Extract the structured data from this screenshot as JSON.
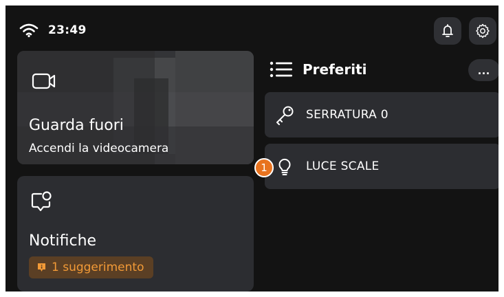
{
  "status_bar": {
    "time": "23:49",
    "wifi_icon": "wifi-icon",
    "notification_icon": "bell-icon",
    "settings_icon": "gear-icon"
  },
  "camera_card": {
    "icon": "video-camera-icon",
    "title": "Guarda fuori",
    "subtitle": "Accendi la videocamera"
  },
  "notifications_card": {
    "icon": "chat-bubble-icon",
    "title": "Notifiche",
    "badge_icon": "info-icon",
    "badge_label": "1 suggerimento",
    "badge_color": "#f29a37"
  },
  "favorites": {
    "icon": "list-icon",
    "title": "Preferiti",
    "more_icon": "more-icon",
    "more_label": "...",
    "items": [
      {
        "icon": "key-icon",
        "label": "SERRATURA 0"
      },
      {
        "icon": "lightbulb-icon",
        "label": "LUCE SCALE",
        "badge": "1"
      }
    ]
  },
  "colors": {
    "background": "#131313",
    "card": "#2c2d31",
    "accent": "#e8731f"
  }
}
